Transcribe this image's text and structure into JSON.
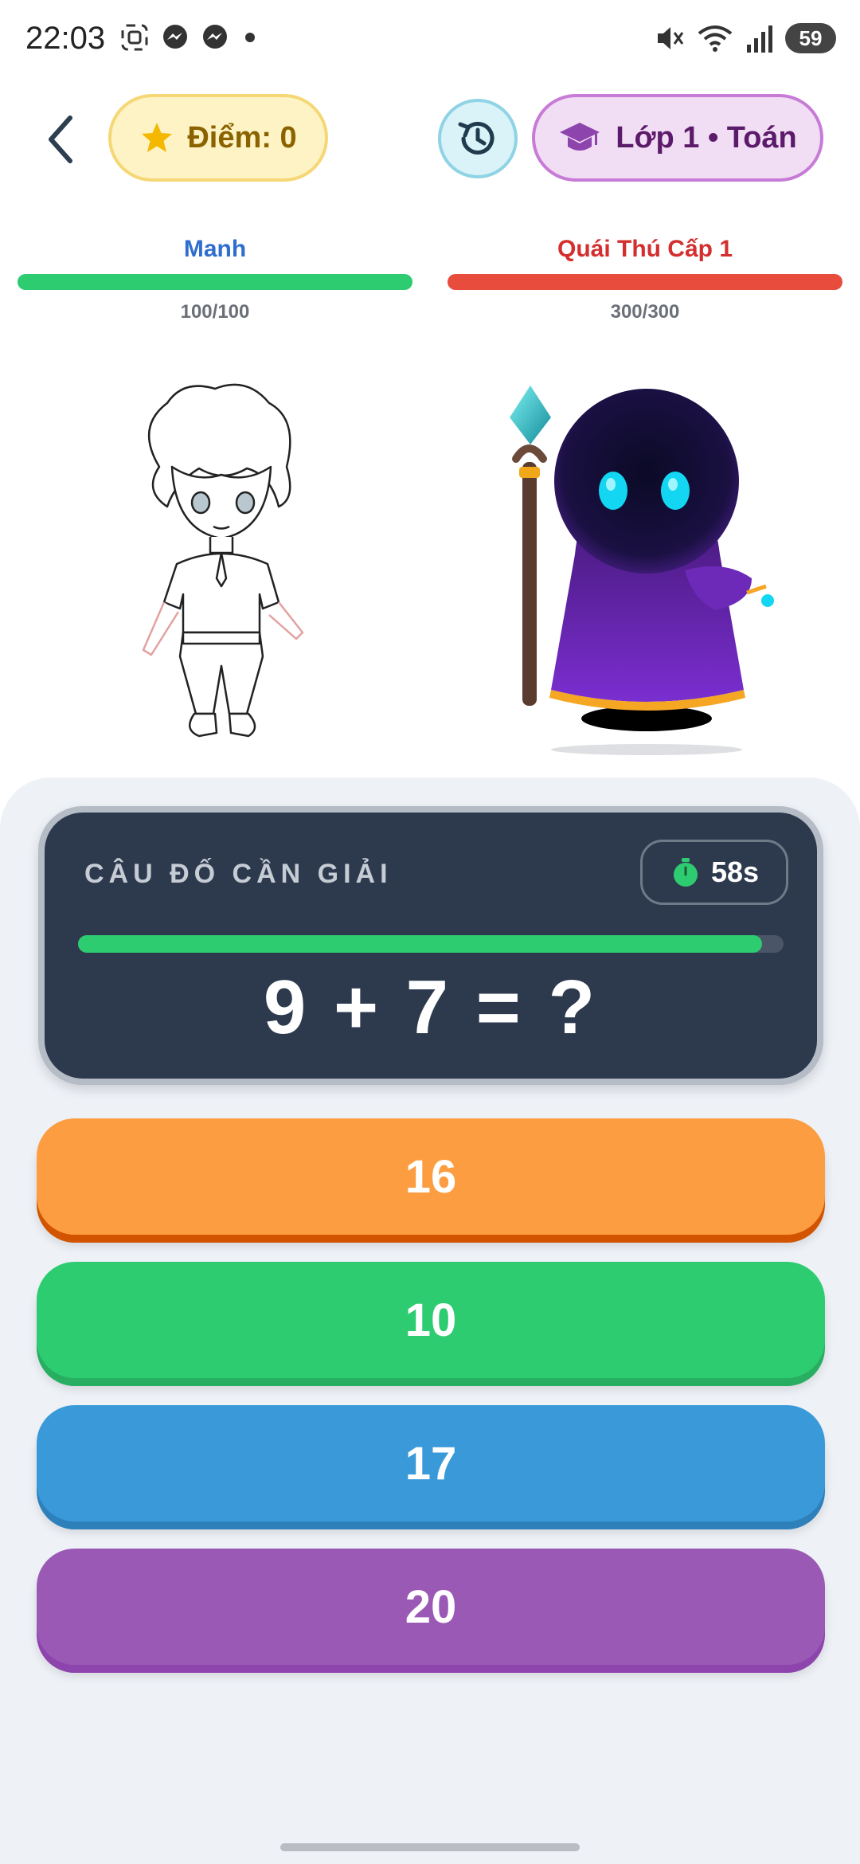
{
  "status_bar": {
    "time": "22:03",
    "battery": "59",
    "icons": [
      "screenshot-icon",
      "messenger-icon",
      "messenger-icon",
      "dot-icon",
      "mute-icon",
      "wifi-icon",
      "signal-icon",
      "battery-icon"
    ]
  },
  "header": {
    "score_label": "Điểm: 0",
    "class_label": "Lớp 1 • Toán",
    "colors": {
      "score_bg": "#fdf3c4",
      "class_bg": "#f1ddf4",
      "history_bg": "#d9f3f8"
    }
  },
  "player": {
    "name": "Manh",
    "hp_text": "100/100",
    "hp_fraction": 1.0,
    "color": "#2ecc71",
    "name_color": "#2f6ecf"
  },
  "enemy": {
    "name": "Quái Thú Cấp 1",
    "hp_text": "300/300",
    "hp_fraction": 1.0,
    "color": "#e74c3c",
    "name_color": "#d32f2f"
  },
  "question": {
    "label": "CÂU ĐỐ CẦN GIẢI",
    "timer": "58s",
    "time_fraction": 0.97,
    "text": "9 + 7 = ?"
  },
  "answers": [
    {
      "label": "16",
      "color": "#fd9d41",
      "shade": "#d35400"
    },
    {
      "label": "10",
      "color": "#2ecc71",
      "shade": "#27ae60"
    },
    {
      "label": "17",
      "color": "#3a9ad9",
      "shade": "#2e80bb"
    },
    {
      "label": "20",
      "color": "#9b59b6",
      "shade": "#8e44ad"
    }
  ]
}
